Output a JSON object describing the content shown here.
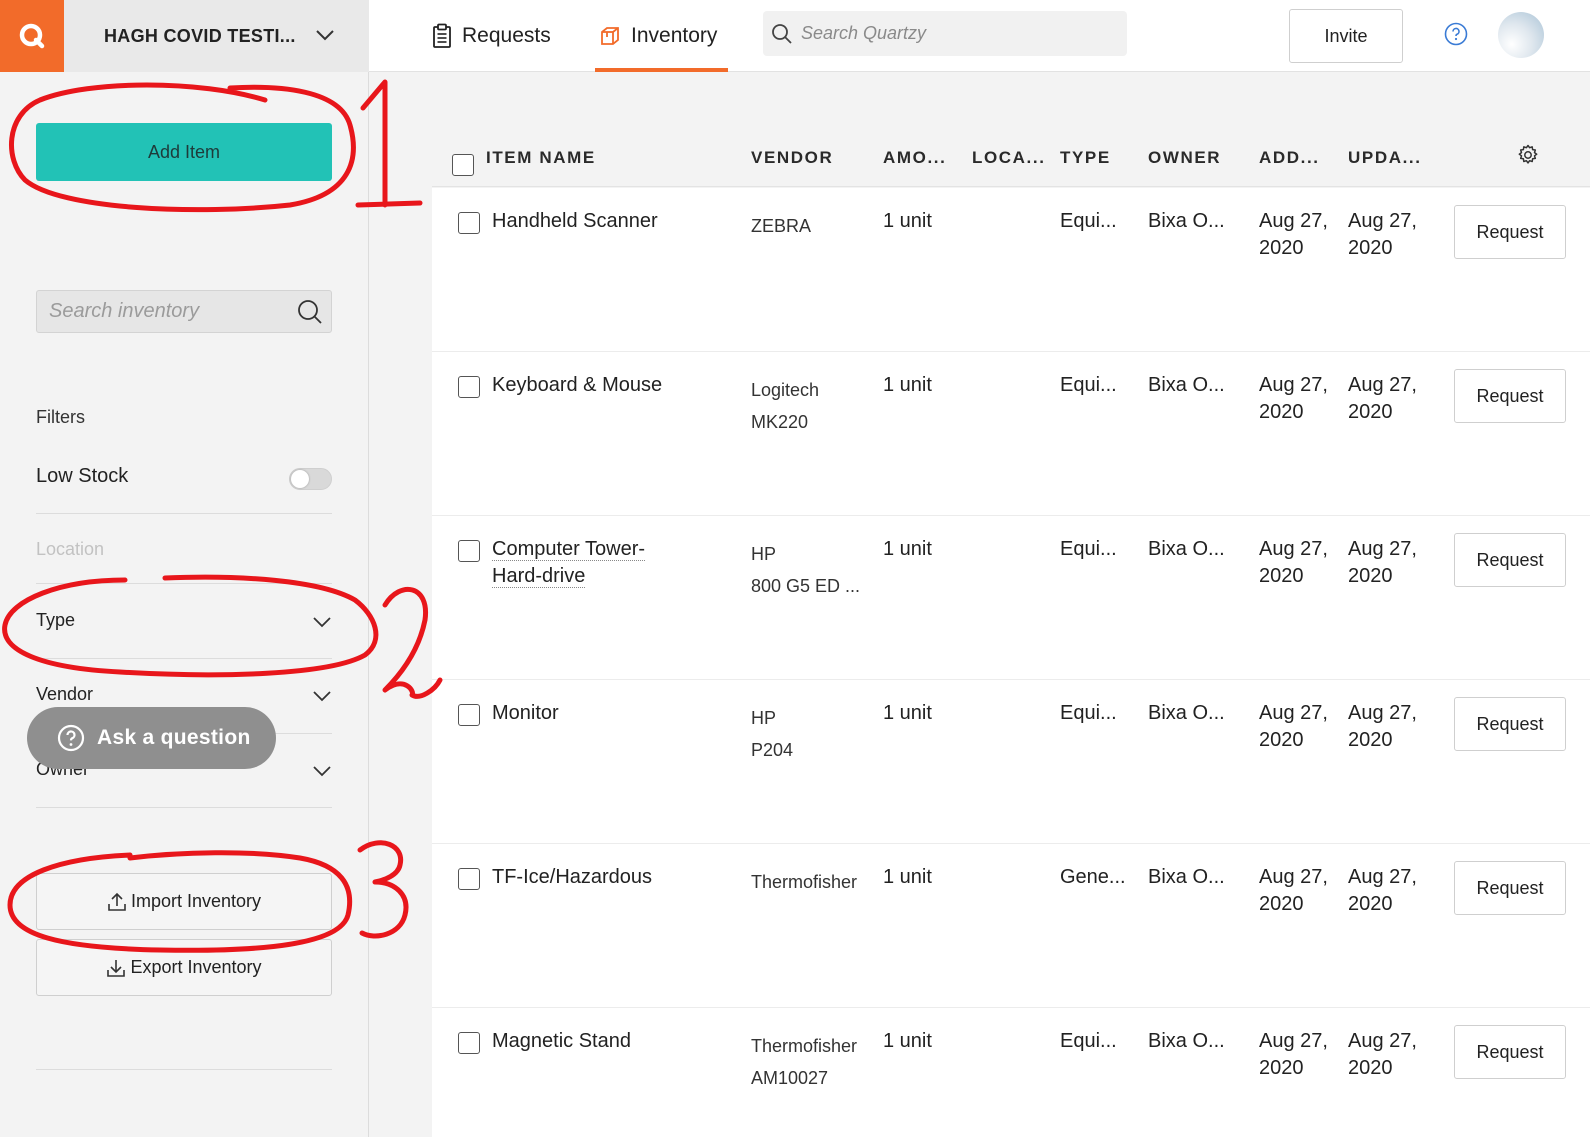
{
  "topbar": {
    "org_name": "HAGH COVID TESTI...",
    "tabs": [
      {
        "label": "Requests",
        "icon": "clipboard-icon"
      },
      {
        "label": "Inventory",
        "icon": "box-icon",
        "active": true
      }
    ],
    "search_placeholder": "Search Quartzy",
    "invite_label": "Invite"
  },
  "sidebar": {
    "add_item_label": "Add Item",
    "search_placeholder": "Search inventory",
    "filters_label": "Filters",
    "low_stock_label": "Low Stock",
    "low_stock_on": false,
    "location_label": "Location",
    "type_label": "Type",
    "vendor_label": "Vendor",
    "owner_label": "Owner",
    "ask_label": "Ask a question",
    "import_label": "Import Inventory",
    "export_label": "Export Inventory"
  },
  "table": {
    "columns": [
      "ITEM NAME",
      "VENDOR",
      "AMO...",
      "LOCA...",
      "TYPE",
      "OWNER",
      "ADD...",
      "UPDA..."
    ],
    "request_label": "Request",
    "rows": [
      {
        "name": "Handheld Scanner",
        "vendor": "ZEBRA",
        "vendor_line2": "",
        "amount": "1 unit",
        "type": "Equi...",
        "owner": "Bixa O...",
        "added_1": "Aug 27,",
        "added_2": "2020",
        "updated_1": "Aug 27,",
        "updated_2": "2020"
      },
      {
        "name": "Keyboard & Mouse",
        "vendor": "Logitech",
        "vendor_line2": "MK220",
        "amount": "1 unit",
        "type": "Equi...",
        "owner": "Bixa O...",
        "added_1": "Aug 27,",
        "added_2": "2020",
        "updated_1": "Aug 27,",
        "updated_2": "2020"
      },
      {
        "name": "Computer Tower-Hard-drive",
        "name_line1": "Computer Tower-",
        "name_line2": "Hard-drive",
        "vendor": "HP",
        "vendor_line2": "800 G5 ED ...",
        "amount": "1 unit",
        "type": "Equi...",
        "owner": "Bixa O...",
        "added_1": "Aug 27,",
        "added_2": "2020",
        "updated_1": "Aug 27,",
        "updated_2": "2020"
      },
      {
        "name": "Monitor",
        "vendor": "HP",
        "vendor_line2": "P204",
        "amount": "1 unit",
        "type": "Equi...",
        "owner": "Bixa O...",
        "added_1": "Aug 27,",
        "added_2": "2020",
        "updated_1": "Aug 27,",
        "updated_2": "2020"
      },
      {
        "name": "TF-Ice/Hazardous",
        "vendor": "Thermofisher",
        "vendor_line2": "",
        "amount": "1 unit",
        "type": "Gene...",
        "owner": "Bixa O...",
        "added_1": "Aug 27,",
        "added_2": "2020",
        "updated_1": "Aug 27,",
        "updated_2": "2020"
      },
      {
        "name": "Magnetic Stand",
        "vendor": "Thermofisher",
        "vendor_line2": "AM10027",
        "amount": "1 unit",
        "type": "Equi...",
        "owner": "Bixa O...",
        "added_1": "Aug 27,",
        "added_2": "2020",
        "updated_1": "Aug 27,",
        "updated_2": "2020"
      }
    ]
  },
  "annotations": {
    "marks": [
      "1",
      "2",
      "3"
    ],
    "color": "#e8161b"
  },
  "colors": {
    "brand_orange": "#f26b2a",
    "add_item_teal": "#22c2b6"
  }
}
